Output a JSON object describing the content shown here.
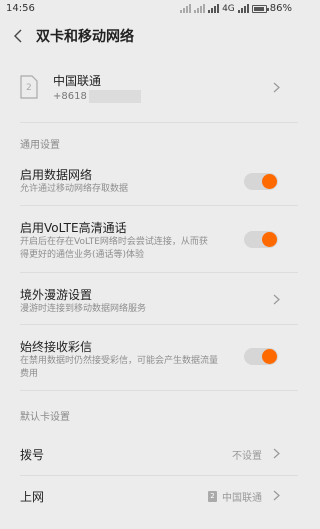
{
  "status_bar": {
    "time": "14:56",
    "network_type": "4G",
    "battery_percent": "86%"
  },
  "header": {
    "title": "双卡和移动网络"
  },
  "sim": {
    "slot_number": "2",
    "carrier": "中国联通",
    "number_prefix": "+8618"
  },
  "general": {
    "section_label": "通用设置",
    "mobile_data": {
      "title": "启用数据网络",
      "desc": "允许通过移动网络存取数据",
      "on": true
    },
    "volte": {
      "title": "启用VoLTE高清通话",
      "desc_line1": "开启后在存在VoLTE网络时会尝试连接，从而获",
      "desc_line2": "得更好的通信业务(通话等)体验",
      "on": true
    },
    "roaming": {
      "title": "境外漫游设置",
      "desc": "漫游时连接到移动数据网络服务"
    },
    "mms": {
      "title": "始终接收彩信",
      "desc_line1": "在禁用数据时仍然接受彩信，可能会产生数据流量",
      "desc_line2": "费用",
      "on": true
    }
  },
  "default_sim": {
    "section_label": "默认卡设置",
    "dial": {
      "title": "拨号",
      "value": "不设置"
    },
    "internet": {
      "title": "上网",
      "badge": "2",
      "value": "中国联通"
    }
  },
  "colors": {
    "accent": "#ff6a00",
    "background": "#ececec"
  }
}
